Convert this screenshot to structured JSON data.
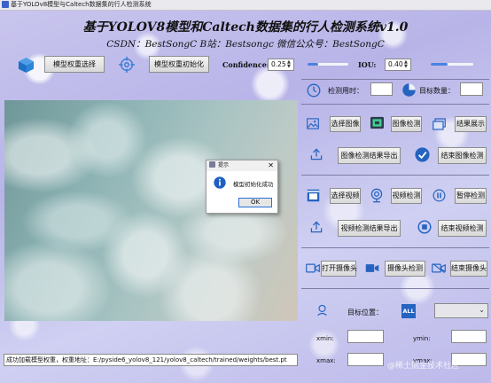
{
  "window": {
    "title": "基于YOLOv8模型与Caltech数据集的行人检测系统"
  },
  "header": {
    "title": "基于YOLOV8模型和Caltech数据集的行人检测系统v1.0",
    "subtitle": "CSDN：BestSongC   B站：Bestsongc   微信公众号：BestSongC"
  },
  "toolbar": {
    "model_select_label": "模型权重选择",
    "model_init_label": "模型权重初始化",
    "confidence_label": "Confidence:",
    "confidence_value": "0.25",
    "confidence_level": 0.25,
    "iou_label": "IOU:",
    "iou_value": "0.40",
    "iou_level": 0.4
  },
  "stats": {
    "elapsed_label": "检测用时：",
    "elapsed_value": "",
    "count_label": "目标数量："
  },
  "image_section": {
    "select_label": "选择图像",
    "detect_label": "图像检测",
    "show_label": "结果展示",
    "export_label": "图像检测结果导出",
    "finish_label": "结束图像检测"
  },
  "video_section": {
    "select_label": "选择视频",
    "detect_label": "视频检测",
    "pause_label": "暂停检测",
    "export_label": "视频检测结果导出",
    "finish_label": "结束视频检测"
  },
  "camera_section": {
    "open_label": "打开摄像头",
    "detect_label": "摄像头检测",
    "finish_label": "结束摄像头"
  },
  "target": {
    "position_label": "目标位置：",
    "badge_label": "ALL",
    "xmin_label": "xmin:",
    "ymin_label": "ymin:",
    "xmax_label": "xmax:",
    "ymax_label": "ymax:"
  },
  "dialog": {
    "title": "提示",
    "message": "模型初始化成功",
    "ok_label": "OK"
  },
  "status": {
    "text": "成功加载模型权重，权重地址：E:/pyside6_yolov8_121/yolov8_caltech/trained/weights/best.pt"
  },
  "watermark": "@稀土掘金技术社区",
  "colors": {
    "accent": "#4a82e0",
    "panel": "#bdb9ea"
  }
}
